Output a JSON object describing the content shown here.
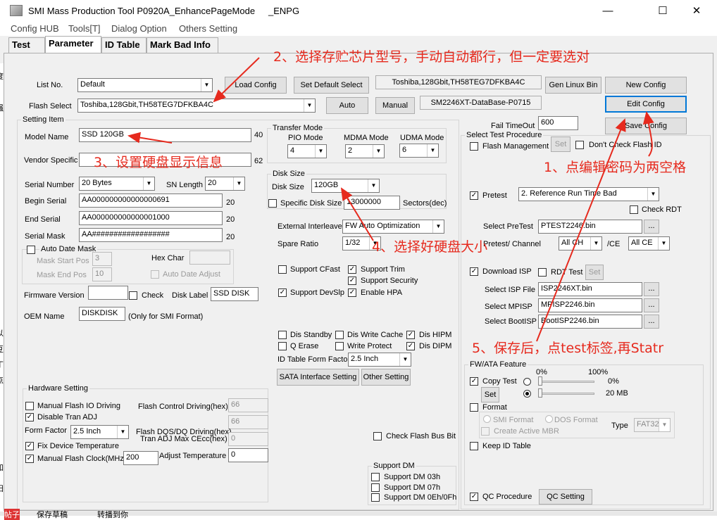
{
  "window": {
    "title": "SMI Mass Production Tool P0920A_EnhancePageMode",
    "title_suffix": "_ENPG",
    "minimize": "—",
    "maximize": "☐",
    "close": "✕"
  },
  "menu": [
    "Config HUB",
    "Tools[T]",
    "Dialog Option",
    "Others Setting"
  ],
  "tabs": [
    "Test",
    "Parameter",
    "ID Table",
    "Mark Bad Info"
  ],
  "top": {
    "list_no_label": "List No.",
    "list_no_value": "Default",
    "flash_select_label": "Flash Select",
    "flash_select_value": "Toshiba,128Gbit,TH58TEG7DFKBA4C",
    "load_config": "Load Config",
    "set_default_select": "Set Default Select",
    "auto": "Auto",
    "manual": "Manual",
    "flash_info": "Toshiba,128Gbit,TH58TEG7DFKBA4C",
    "database_info": "SM2246XT-DataBase-P0715",
    "gen_linux_bin": "Gen Linux Bin",
    "new_config": "New Config",
    "edit_config": "Edit Config",
    "save_config": "Save Config",
    "fail_timeout_label": "Fail TimeOut",
    "fail_timeout_value": "600"
  },
  "setting_item": {
    "title": "Setting Item",
    "model_name_label": "Model Name",
    "model_name_value": "SSD 120GB",
    "model_name_len": "40",
    "vendor_specific_label": "Vendor Specific",
    "vendor_specific_len": "62",
    "serial_number_label": "Serial Number",
    "serial_number_value": "20 Bytes",
    "sn_length_label": "SN Length",
    "sn_length_value": "20",
    "begin_serial_label": "Begin Serial",
    "begin_serial_value": "AA000000000000000691",
    "begin_serial_len": "20",
    "end_serial_label": "End Serial",
    "end_serial_value": "AA000000000000001000",
    "end_serial_len": "20",
    "serial_mask_label": "Serial Mask",
    "serial_mask_value": "AA##################",
    "serial_mask_len": "20",
    "auto_date_mask": "Auto Date Mask",
    "mask_start_pos_label": "Mask Start Pos",
    "mask_start_pos_value": "3",
    "mask_end_pos_label": "Mask End Pos",
    "mask_end_pos_value": "10",
    "hex_char_label": "Hex Char",
    "auto_date_adjust": "Auto Date Adjust",
    "firmware_version_label": "Firmware Version",
    "check_label": "Check",
    "disk_label_label": "Disk Label",
    "disk_label_value": "SSD DISK",
    "oem_name_label": "OEM Name",
    "oem_name_value": "DISKDISK",
    "oem_note": "(Only for SMI Format)"
  },
  "transfer_mode": {
    "title": "Transfer Mode",
    "pio_label": "PIO Mode",
    "pio_value": "4",
    "mdma_label": "MDMA Mode",
    "mdma_value": "2",
    "udma_label": "UDMA Mode",
    "udma_value": "6"
  },
  "disk_size": {
    "title": "Disk Size",
    "disk_size_label": "Disk Size",
    "disk_size_value": "120GB",
    "specific_label": "Specific Disk Size",
    "specific_value": "13000000",
    "sectors_label": "Sectors(dec)"
  },
  "middle": {
    "external_interleave_label": "External Interleave",
    "external_interleave_value": "FW Auto Optimization",
    "spare_ratio_label": "Spare Ratio",
    "spare_ratio_value": "1/32",
    "support_cfast": "Support CFast",
    "support_trim": "Support Trim",
    "support_security": "Support Security",
    "support_devslp": "Support DevSlp",
    "enable_hpa": "Enable HPA",
    "dis_standby": "Dis Standby",
    "dis_write_cache": "Dis Write Cache",
    "dis_hipm": "Dis HIPM",
    "q_erase": "Q Erase",
    "write_protect": "Write Protect",
    "dis_dipm": "Dis DIPM",
    "id_table_form_factor_label": "ID Table Form Factor",
    "id_table_form_factor_value": "2.5 Inch",
    "sata_interface_setting": "SATA Interface Setting",
    "other_setting": "Other Setting",
    "check_flash_bus_bit": "Check Flash Bus Bit"
  },
  "hardware": {
    "title": "Hardware Setting",
    "manual_flash_io": "Manual Flash IO Driving",
    "flash_control_driving_label": "Flash Control Driving(hex)",
    "flash_control_driving_value": "66",
    "disable_tran_adj": "Disable Tran ADJ",
    "flash_dqs_label": "Flash DQS/DQ Driving(hex)",
    "flash_dqs_value": "66",
    "form_factor_label": "Form Factor",
    "form_factor_value": "2.5 Inch",
    "tran_adj_max_label": "Tran ADJ Max CEcc(hex)",
    "tran_adj_max_value": "0",
    "fix_device_temperature": "Fix Device Temperature",
    "manual_flash_clock": "Manual Flash Clock(MHz)",
    "flash_clock_value": "200",
    "adjust_temperature_label": "Adjust Temperature",
    "adjust_temperature_value": "0"
  },
  "support_dm": {
    "title": "Support DM",
    "dm03": "Support DM 03h",
    "dm07": "Support DM 07h",
    "dm0e": "Support DM 0Eh/0Fh"
  },
  "test_procedure": {
    "title": "Select Test Procedure",
    "flash_management": "Flash Management",
    "set": "Set",
    "dont_check_flash_id": "Don't Check Flash ID",
    "pretest": "Pretest",
    "pretest_value": "2. Reference Run Time Bad",
    "check_rdt": "Check RDT",
    "select_pretest_label": "Select PreTest",
    "select_pretest_value": "PTEST2246.bin",
    "browse": "...",
    "pretest_channel_label": "Pretest/ Channel",
    "pretest_channel_value": "All CH",
    "ce_label": "/CE",
    "ce_value": "All CE",
    "download_isp": "Download ISP",
    "rdt_test": "RDT Test",
    "select_isp_label": "Select ISP File",
    "select_isp_value": "ISP2246XT.bin",
    "select_mpisp_label": "Select MPISP",
    "select_mpisp_value": "MPISP2246.bin",
    "select_bootisp_label": "Select BootISP",
    "select_bootisp_value": "BootISP2246.bin"
  },
  "fw_ata": {
    "title": "FW/ATA Feature",
    "pct0": "0%",
    "pct100": "100%",
    "copy_test": "Copy Test",
    "copy_pct": "0%",
    "set": "Set",
    "copy_mb": "20 MB",
    "format": "Format",
    "smi_format": "SMI Format",
    "dos_format": "DOS Format",
    "create_active_mbr": "Create Active MBR",
    "type_label": "Type",
    "type_value": "FAT32",
    "keep_id_table": "Keep ID Table",
    "qc_procedure": "QC Procedure",
    "qc_setting": "QC Setting"
  },
  "annotations": {
    "a1": "1、点编辑密码为两空格",
    "a2": "2、选择存贮芯片型号，手动自动都行，但一定要选对",
    "a3": "3、设置硬盘显示信息",
    "a4": "4、选择好硬盘大小",
    "a5": "5、保存后，点test标签,再Statr"
  },
  "left_strip": [
    "度",
    "强",
    "以",
    "豆",
    "丁",
    "点",
    "加",
    "阳",
    "帖子"
  ],
  "bottom_strip": [
    "帖子",
    "保存草稿",
    "转播到你"
  ],
  "colors": {
    "annotation": "#e62a1e",
    "focus": "#0078d7"
  }
}
